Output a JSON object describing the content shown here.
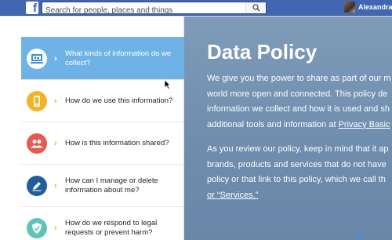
{
  "topbar": {
    "logo_letter": "f",
    "search_placeholder": "Search for people, places and things",
    "user_name": "Alexandra"
  },
  "menu": {
    "items": [
      {
        "label": "What kinds of information do we collect?",
        "icon": "computer-icon",
        "color": "#3b8fd6",
        "active": true
      },
      {
        "label": "How do we use this information?",
        "icon": "phone-icon",
        "color": "#f5b324",
        "active": false
      },
      {
        "label": "How is this information shared?",
        "icon": "people-icon",
        "color": "#e85a4f",
        "active": false
      },
      {
        "label": "How can I manage or delete information about me?",
        "icon": "pencil-icon",
        "color": "#1f5f9e",
        "active": false
      },
      {
        "label": "How do we respond to legal requests or prevent harm?",
        "icon": "shield-icon",
        "color": "#5fc4b8",
        "active": false
      }
    ]
  },
  "hero": {
    "title": "Data Policy",
    "para1_lines": [
      "We give you the power to share as part of our m",
      "world more open and connected. This policy de",
      "information we collect and how it is used and sh",
      "additional tools and information at "
    ],
    "para1_link": "Privacy Basic",
    "para2_lines": [
      "As you review our policy, keep in mind that it ap",
      "brands, products and services that do not have",
      "policy or that link to this policy, which we call th"
    ],
    "para2_link": "or “Services.”"
  },
  "colors": {
    "topbar": "#4267b2",
    "active_item": "#6fb3e6",
    "hero_bg": "#7592b3",
    "chevron": "#f5a623"
  }
}
